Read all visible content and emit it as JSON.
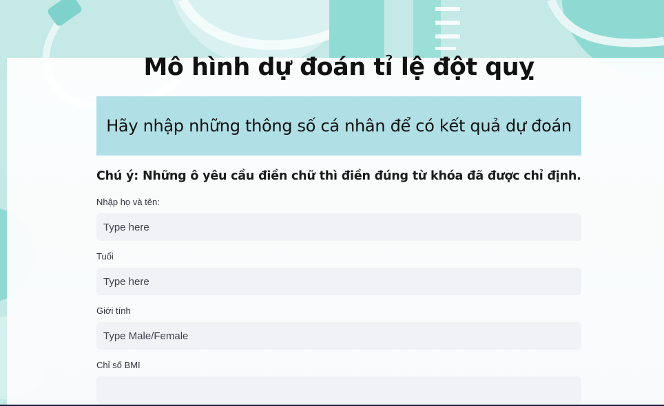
{
  "page": {
    "title": "Mô hình dự đoán tỉ lệ đột quỵ",
    "banner": "Hãy nhập những thông số cá nhân để có kết quả dự đoán",
    "note": "Chú ý: Những ô yêu cầu điền chữ thì điền đúng từ khóa đã được chỉ định."
  },
  "form": {
    "fields": [
      {
        "label": "Nhập họ và tên:",
        "placeholder": "Type here",
        "value": ""
      },
      {
        "label": "Tuổi",
        "placeholder": "Type here",
        "value": ""
      },
      {
        "label": "Giới tính",
        "placeholder": "Type Male/Female",
        "value": ""
      },
      {
        "label": "Chỉ số BMI",
        "placeholder": "",
        "value": ""
      }
    ]
  },
  "colors": {
    "banner_bg": "#b0e0e6",
    "input_bg": "#f0f2f6",
    "background_teal": "#8fd9d3"
  }
}
